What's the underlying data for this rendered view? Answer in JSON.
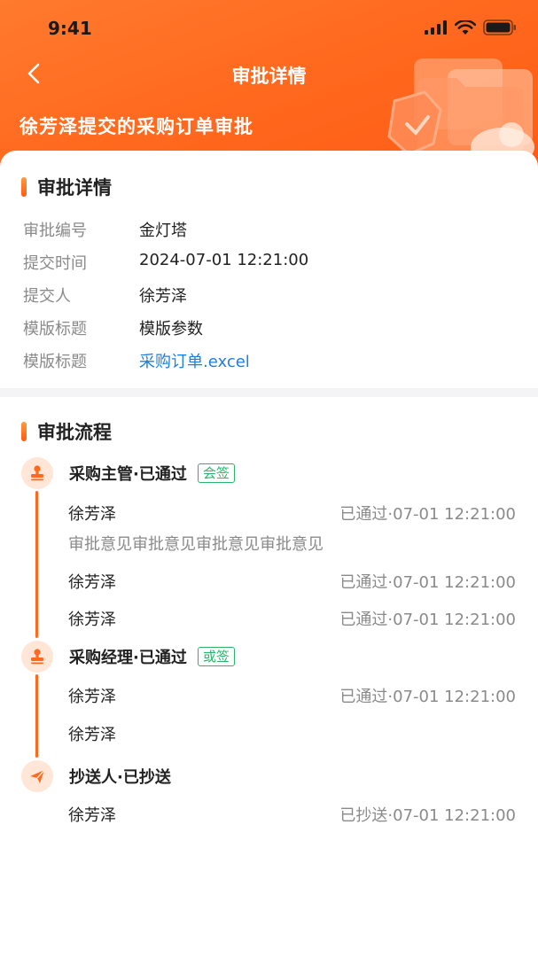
{
  "status_bar": {
    "time": "9:41"
  },
  "nav": {
    "title": "审批详情"
  },
  "header": {
    "subtitle": "徐芳泽提交的采购订单审批"
  },
  "details": {
    "title": "审批详情",
    "rows": [
      {
        "label": "审批编号",
        "value": "金灯塔"
      },
      {
        "label": "提交时间",
        "value": "2024-07-01 12:21:00"
      },
      {
        "label": "提交人",
        "value": "徐芳泽"
      },
      {
        "label": "模版标题",
        "value": "模版参数"
      },
      {
        "label": "模版标题",
        "value": "采购订单.excel"
      }
    ]
  },
  "flow": {
    "title": "审批流程",
    "nodes": [
      {
        "title": "采购主管·已通过",
        "tag": "会签",
        "icon": "stamp-icon",
        "entries": [
          {
            "name": "徐芳泽",
            "status": "已通过·07-01 12:21:00",
            "opinion": "审批意见审批意见审批意见审批意见"
          },
          {
            "name": "徐芳泽",
            "status": "已通过·07-01 12:21:00"
          },
          {
            "name": "徐芳泽",
            "status": "已通过·07-01 12:21:00"
          }
        ]
      },
      {
        "title": "采购经理·已通过",
        "tag": "或签",
        "icon": "stamp-icon",
        "entries": [
          {
            "name": "徐芳泽",
            "status": "已通过·07-01 12:21:00"
          },
          {
            "name": "徐芳泽",
            "status": ""
          }
        ]
      },
      {
        "title": "抄送人·已抄送",
        "icon": "paper-plane-icon",
        "entries": [
          {
            "name": "徐芳泽",
            "status": "已抄送·07-01 12:21:00"
          }
        ]
      }
    ]
  },
  "colors": {
    "accent": "#ff6a1f",
    "link": "#1f7fe0",
    "tag_green": "#2bb56b"
  }
}
